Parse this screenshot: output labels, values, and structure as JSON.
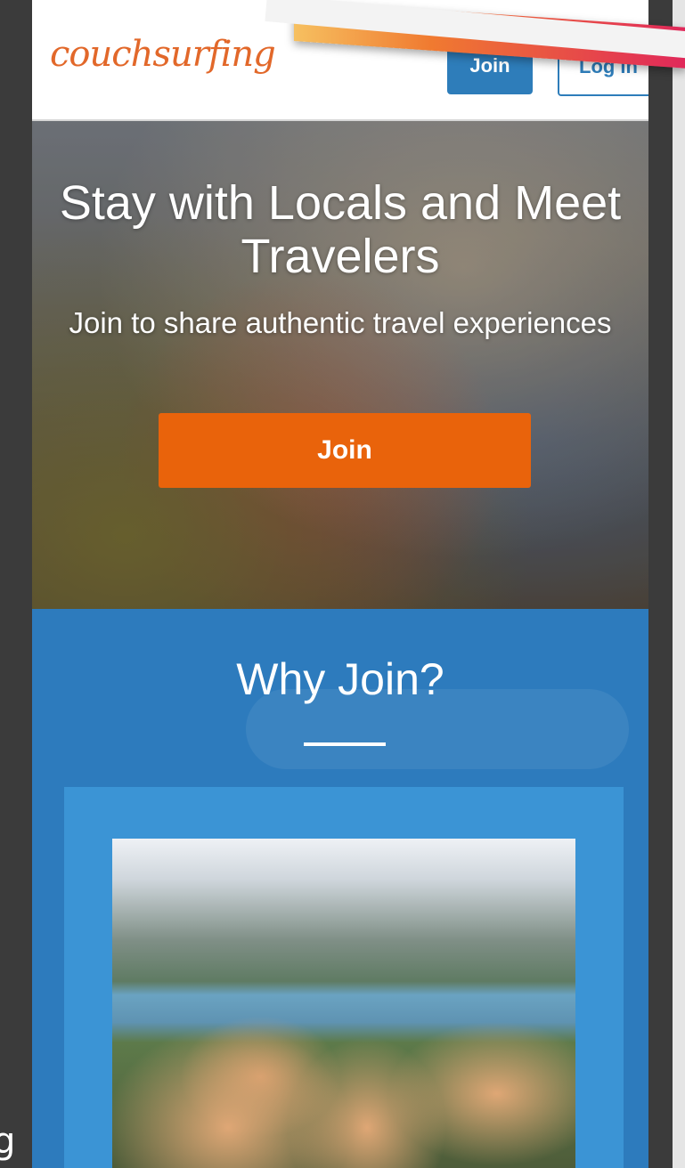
{
  "header": {
    "logo_text": "couchsurfing",
    "join_label": "Join",
    "login_label": "Log In"
  },
  "hero": {
    "title": "Stay with Locals and Meet Travelers",
    "subtitle": "Join to share authentic travel experiences",
    "join_label": "Join"
  },
  "why": {
    "title": "Why Join?"
  },
  "frame": {
    "edge_text": "g"
  },
  "colors": {
    "brand_orange": "#e2682a",
    "primary_blue": "#2e7dba",
    "cta_orange": "#e9630b",
    "section_blue": "#2d7bbd",
    "card_blue": "#3b94d5"
  }
}
